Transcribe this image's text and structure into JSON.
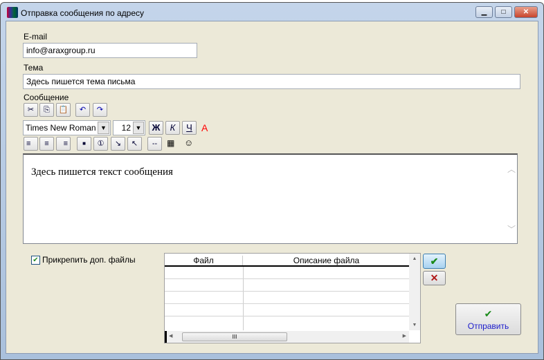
{
  "window": {
    "title": "Отправка сообщения по адресу",
    "minimize": "▁",
    "maximize": "□",
    "close": "✕"
  },
  "email": {
    "label": "E-mail",
    "value": "info@araxgroup.ru"
  },
  "subject": {
    "label": "Тема",
    "value": "Здесь пишется тема письма"
  },
  "message": {
    "label": "Сообщение",
    "body": "Здесь пишется текст сообщения"
  },
  "toolbar": {
    "row1": [
      {
        "name": "cut-icon",
        "glyph": "✂"
      },
      {
        "name": "copy-icon",
        "glyph": "⎘"
      },
      {
        "name": "paste-icon",
        "glyph": "📋"
      },
      {
        "name": "undo-icon",
        "glyph": "↶"
      },
      {
        "name": "redo-icon",
        "glyph": "↷"
      }
    ],
    "font": "Times New Roman",
    "size": "12",
    "bold": "Ж",
    "italic": "К",
    "underline": "Ч",
    "color": "A",
    "row3": [
      {
        "name": "align-left-icon",
        "glyph": "≡"
      },
      {
        "name": "align-center-icon",
        "glyph": "≡"
      },
      {
        "name": "align-right-icon",
        "glyph": "≡"
      },
      {
        "name": "bullet-list-icon",
        "glyph": "■"
      },
      {
        "name": "numbered-list-icon",
        "glyph": "①"
      },
      {
        "name": "indent-icon",
        "glyph": "↘"
      },
      {
        "name": "outdent-icon",
        "glyph": "↖"
      },
      {
        "name": "horizontal-line-icon",
        "glyph": "--"
      },
      {
        "name": "insert-image-icon",
        "glyph": "▦"
      },
      {
        "name": "smiley-icon",
        "glyph": "☺"
      }
    ]
  },
  "attach": {
    "label": "Прикрепить доп. файлы",
    "checked": true
  },
  "files_table": {
    "columns": [
      "Файл",
      "Описание файла"
    ],
    "rows": []
  },
  "buttons": {
    "add": "✔",
    "remove": "✕",
    "send_icon": "✔",
    "send": "Отправить"
  },
  "colors": {
    "accent_green": "#1a8a1a",
    "delete_red": "#b01818",
    "link_blue": "#1a1acc"
  }
}
